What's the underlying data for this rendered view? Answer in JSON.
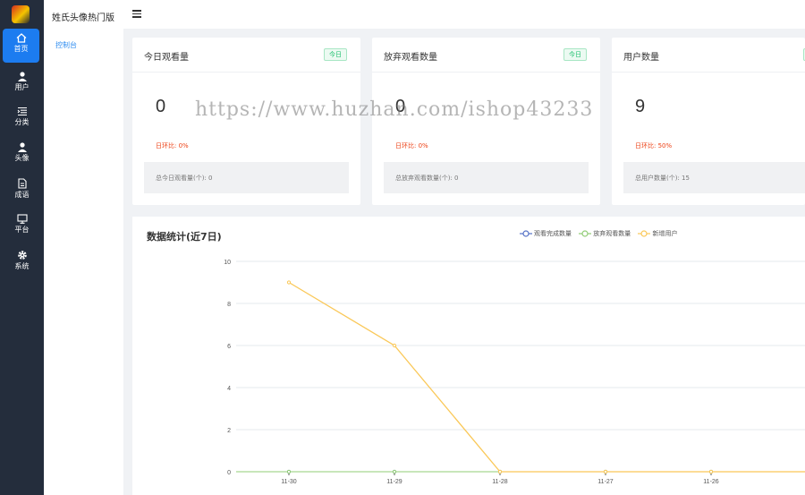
{
  "app": {
    "title": "姓氏头像热门版"
  },
  "nav": {
    "items": [
      {
        "label": "首页",
        "icon": "home-icon",
        "active": true
      },
      {
        "label": "用户",
        "icon": "user-icon",
        "active": false
      },
      {
        "label": "分类",
        "icon": "list-icon",
        "active": false
      },
      {
        "label": "头像",
        "icon": "avatar-icon",
        "active": false
      },
      {
        "label": "成语",
        "icon": "document-icon",
        "active": false
      },
      {
        "label": "平台",
        "icon": "monitor-icon",
        "active": false
      },
      {
        "label": "系统",
        "icon": "gear-icon",
        "active": false
      }
    ],
    "sub_link": "控制台"
  },
  "cards": [
    {
      "title": "今日观看量",
      "badge": "今日",
      "value": "0",
      "ratio": "日环比: 0%",
      "footer": "总今日观看量(个): 0"
    },
    {
      "title": "放弃观看数量",
      "badge": "今日",
      "value": "0",
      "ratio": "日环比: 0%",
      "footer": "总放弃观看数量(个): 0"
    },
    {
      "title": "用户数量",
      "badge": "",
      "value": "9",
      "ratio": "日环比: 50%",
      "footer": "总用户数量(个): 15"
    }
  ],
  "watermark": "https://www.huzhan.com/ishop43233",
  "colors": {
    "accent": "#1c7cf0",
    "rail": "#242d3c",
    "series_blue": "#5470c6",
    "series_green": "#91cc75",
    "series_yellow": "#fac858"
  },
  "chart_data": {
    "type": "line",
    "title": "数据统计(近7日)",
    "categories": [
      "11-30",
      "11-29",
      "11-28",
      "11-27",
      "11-26"
    ],
    "series": [
      {
        "name": "观看完成数量",
        "values": [
          0,
          0,
          0,
          0,
          0
        ],
        "color": "#5470c6"
      },
      {
        "name": "放弃观看数量",
        "values": [
          0,
          0,
          0,
          0,
          0
        ],
        "color": "#91cc75"
      },
      {
        "name": "新增用户",
        "values": [
          9,
          6,
          0,
          0,
          0
        ],
        "color": "#fac858"
      }
    ],
    "y_ticks": [
      "0",
      "2",
      "4",
      "6",
      "8",
      "10"
    ],
    "ylim": [
      0,
      10
    ],
    "grid": true,
    "legend": "top-right"
  }
}
